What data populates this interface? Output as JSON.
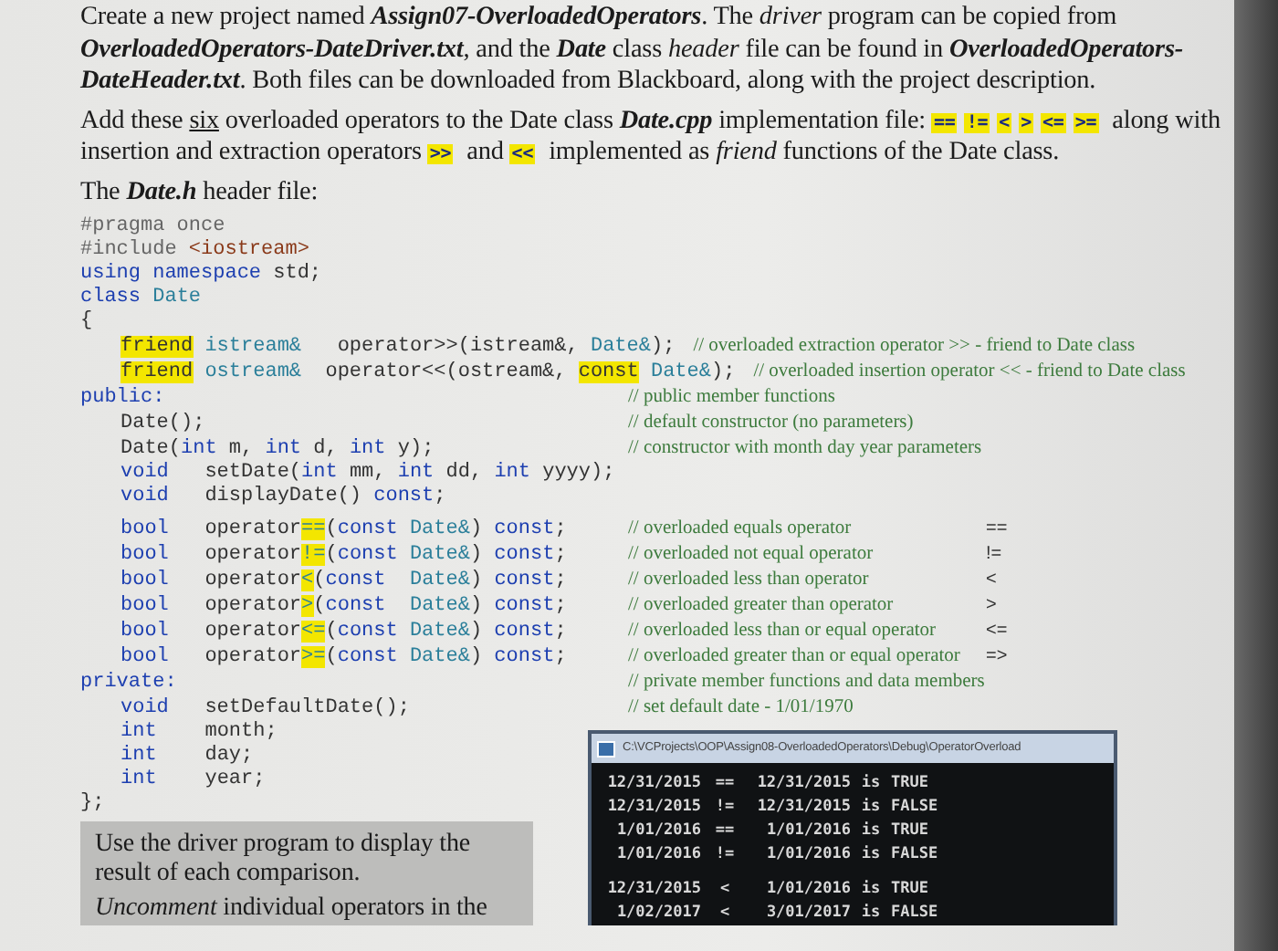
{
  "intro": [
    {
      "segments": [
        {
          "kind": "text",
          "text": "Create a new project named "
        },
        {
          "kind": "bold-italic",
          "text": "Assign07-OverloadedOperators"
        },
        {
          "kind": "text",
          "text": ".  The "
        },
        {
          "kind": "italic",
          "text": "driver"
        },
        {
          "kind": "text",
          "text": " program can be copied from "
        },
        {
          "kind": "bold-italic",
          "text": "OverloadedOperators-DateDriver.txt"
        },
        {
          "kind": "text",
          "text": ", and the "
        },
        {
          "kind": "bold-italic",
          "text": "Date"
        },
        {
          "kind": "text",
          "text": " class "
        },
        {
          "kind": "italic",
          "text": "header"
        },
        {
          "kind": "text",
          "text": " file can be found in "
        },
        {
          "kind": "bold-italic",
          "text": "OverloadedOperators-DateHeader.txt"
        },
        {
          "kind": "text",
          "text": ".  Both files can be downloaded from Blackboard, along with the project description."
        }
      ]
    },
    {
      "segments": [
        {
          "kind": "text",
          "text": "Add these "
        },
        {
          "kind": "underline",
          "text": "six"
        },
        {
          "kind": "text",
          "text": " overloaded operators to the Date class "
        },
        {
          "kind": "bold-italic",
          "text": "Date.cpp"
        },
        {
          "kind": "text",
          "text": " implementation file: "
        },
        {
          "kind": "mark",
          "text": "=="
        },
        {
          "kind": "mark",
          "text": "!="
        },
        {
          "kind": "mark",
          "text": "<"
        },
        {
          "kind": "mark",
          "text": ">"
        },
        {
          "kind": "mark",
          "text": "<="
        },
        {
          "kind": "mark",
          "text": ">="
        },
        {
          "kind": "text",
          "text": " along with insertion and extraction operators "
        },
        {
          "kind": "mark",
          "text": ">>"
        },
        {
          "kind": "text",
          "text": " and "
        },
        {
          "kind": "mark",
          "text": "<<"
        },
        {
          "kind": "text",
          "text": " implemented as "
        },
        {
          "kind": "italic",
          "text": "friend"
        },
        {
          "kind": "text",
          "text": " functions of the Date class."
        }
      ]
    },
    {
      "segments": [
        {
          "kind": "text",
          "text": "The "
        },
        {
          "kind": "bold-italic",
          "text": "Date.h"
        },
        {
          "kind": "text",
          "text": " header file:"
        }
      ]
    }
  ],
  "code": {
    "lines": [
      {
        "indent": false,
        "segments": [
          {
            "kind": "pre",
            "text": "#pragma once"
          }
        ]
      },
      {
        "indent": false,
        "segments": [
          {
            "kind": "pre",
            "text": "#include "
          },
          {
            "kind": "str",
            "text": "<iostream>"
          }
        ]
      },
      {
        "indent": false,
        "segments": [
          {
            "kind": "kw",
            "text": "using namespace"
          },
          {
            "kind": "plain",
            "text": " std;"
          }
        ]
      },
      {
        "indent": false,
        "segments": [
          {
            "kind": "kw",
            "text": "class"
          },
          {
            "kind": "type",
            "text": " Date"
          }
        ]
      },
      {
        "indent": false,
        "segments": [
          {
            "kind": "plain",
            "text": "{"
          }
        ]
      },
      {
        "indent": true,
        "segments": [
          {
            "kind": "hl",
            "text": "friend"
          },
          {
            "kind": "type",
            "text": " istream&"
          },
          {
            "kind": "plain",
            "text": "   operator>>(istream&, "
          },
          {
            "kind": "type",
            "text": "Date&"
          },
          {
            "kind": "plain",
            "text": ");"
          }
        ],
        "comment": "// overloaded extraction operator >> - friend to Date class"
      },
      {
        "indent": true,
        "segments": [
          {
            "kind": "hl",
            "text": "friend"
          },
          {
            "kind": "type",
            "text": " ostream&"
          },
          {
            "kind": "plain",
            "text": "  operator<<(ostream&, "
          },
          {
            "kind": "hl",
            "text": "const"
          },
          {
            "kind": "type",
            "text": " Date&"
          },
          {
            "kind": "plain",
            "text": ");"
          }
        ],
        "comment": "// overloaded insertion  operator << - friend to Date class"
      },
      {
        "indent": false,
        "segments": [
          {
            "kind": "kw",
            "text": "public:"
          }
        ],
        "comment": "// public member functions"
      },
      {
        "indent": true,
        "segments": [
          {
            "kind": "plain",
            "text": "Date();"
          }
        ],
        "comment": "// default constructor (no parameters)"
      },
      {
        "indent": true,
        "segments": [
          {
            "kind": "plain",
            "text": "Date("
          },
          {
            "kind": "kw",
            "text": "int"
          },
          {
            "kind": "plain",
            "text": " m, "
          },
          {
            "kind": "kw",
            "text": "int"
          },
          {
            "kind": "plain",
            "text": " d, "
          },
          {
            "kind": "kw",
            "text": "int"
          },
          {
            "kind": "plain",
            "text": " y);"
          }
        ],
        "comment": "// constructor with month day year parameters"
      },
      {
        "indent": true,
        "segments": [
          {
            "kind": "kw",
            "text": "void"
          },
          {
            "kind": "plain",
            "text": "   setDate("
          },
          {
            "kind": "kw",
            "text": "int"
          },
          {
            "kind": "plain",
            "text": " mm, "
          },
          {
            "kind": "kw",
            "text": "int"
          },
          {
            "kind": "plain",
            "text": " dd, "
          },
          {
            "kind": "kw",
            "text": "int"
          },
          {
            "kind": "plain",
            "text": " yyyy);"
          }
        ]
      },
      {
        "indent": true,
        "segments": [
          {
            "kind": "kw",
            "text": "void"
          },
          {
            "kind": "plain",
            "text": "   displayDate() "
          },
          {
            "kind": "kw",
            "text": "const"
          },
          {
            "kind": "plain",
            "text": ";"
          }
        ]
      },
      {
        "indent": true,
        "gap": true,
        "segments": [
          {
            "kind": "kw",
            "text": "bool"
          },
          {
            "kind": "plain",
            "text": "   operator"
          },
          {
            "kind": "mark",
            "text": "=="
          },
          {
            "kind": "plain",
            "text": "("
          },
          {
            "kind": "kw",
            "text": "const"
          },
          {
            "kind": "type",
            "text": " Date&"
          },
          {
            "kind": "plain",
            "text": ") "
          },
          {
            "kind": "kw",
            "text": "const"
          },
          {
            "kind": "plain",
            "text": ";"
          }
        ],
        "comment": "// overloaded equals operator",
        "symbol": "=="
      },
      {
        "indent": true,
        "segments": [
          {
            "kind": "kw",
            "text": "bool"
          },
          {
            "kind": "plain",
            "text": "   operator"
          },
          {
            "kind": "mark",
            "text": "!="
          },
          {
            "kind": "plain",
            "text": "("
          },
          {
            "kind": "kw",
            "text": "const"
          },
          {
            "kind": "type",
            "text": " Date&"
          },
          {
            "kind": "plain",
            "text": ") "
          },
          {
            "kind": "kw",
            "text": "const"
          },
          {
            "kind": "plain",
            "text": ";"
          }
        ],
        "comment": "// overloaded not equal operator",
        "symbol": "!="
      },
      {
        "indent": true,
        "segments": [
          {
            "kind": "kw",
            "text": "bool"
          },
          {
            "kind": "plain",
            "text": "   operator"
          },
          {
            "kind": "mark",
            "text": "<"
          },
          {
            "kind": "plain",
            "text": "("
          },
          {
            "kind": "kw",
            "text": "const"
          },
          {
            "kind": "type",
            "text": "  Date&"
          },
          {
            "kind": "plain",
            "text": ") "
          },
          {
            "kind": "kw",
            "text": "const"
          },
          {
            "kind": "plain",
            "text": ";"
          }
        ],
        "comment": "// overloaded less than operator",
        "symbol": "<"
      },
      {
        "indent": true,
        "segments": [
          {
            "kind": "kw",
            "text": "bool"
          },
          {
            "kind": "plain",
            "text": "   operator"
          },
          {
            "kind": "mark",
            "text": ">"
          },
          {
            "kind": "plain",
            "text": "("
          },
          {
            "kind": "kw",
            "text": "const"
          },
          {
            "kind": "type",
            "text": "  Date&"
          },
          {
            "kind": "plain",
            "text": ") "
          },
          {
            "kind": "kw",
            "text": "const"
          },
          {
            "kind": "plain",
            "text": ";"
          }
        ],
        "comment": "// overloaded greater than operator",
        "symbol": ">"
      },
      {
        "indent": true,
        "segments": [
          {
            "kind": "kw",
            "text": "bool"
          },
          {
            "kind": "plain",
            "text": "   operator"
          },
          {
            "kind": "mark",
            "text": "<="
          },
          {
            "kind": "plain",
            "text": "("
          },
          {
            "kind": "kw",
            "text": "const"
          },
          {
            "kind": "type",
            "text": " Date&"
          },
          {
            "kind": "plain",
            "text": ") "
          },
          {
            "kind": "kw",
            "text": "const"
          },
          {
            "kind": "plain",
            "text": ";"
          }
        ],
        "comment": "// overloaded less than or equal operator",
        "symbol": "<="
      },
      {
        "indent": true,
        "segments": [
          {
            "kind": "kw",
            "text": "bool"
          },
          {
            "kind": "plain",
            "text": "   operator"
          },
          {
            "kind": "mark",
            "text": ">="
          },
          {
            "kind": "plain",
            "text": "("
          },
          {
            "kind": "kw",
            "text": "const"
          },
          {
            "kind": "type",
            "text": " Date&"
          },
          {
            "kind": "plain",
            "text": ") "
          },
          {
            "kind": "kw",
            "text": "const"
          },
          {
            "kind": "plain",
            "text": ";"
          }
        ],
        "comment": "// overloaded greater than or equal operator",
        "symbol": "=>"
      },
      {
        "indent": false,
        "segments": [
          {
            "kind": "kw",
            "text": "private:"
          }
        ],
        "comment": "// private member functions and data members"
      },
      {
        "indent": true,
        "segments": [
          {
            "kind": "kw",
            "text": "void"
          },
          {
            "kind": "plain",
            "text": "   setDefaultDate();"
          }
        ],
        "comment": "// set default date -  1/01/1970"
      }
    ]
  },
  "lower_code": {
    "lines": [
      {
        "indent": true,
        "segments": [
          {
            "kind": "kw",
            "text": "int"
          },
          {
            "kind": "plain",
            "text": "    month;"
          }
        ]
      },
      {
        "indent": true,
        "segments": [
          {
            "kind": "kw",
            "text": "int"
          },
          {
            "kind": "plain",
            "text": "    day;"
          }
        ]
      },
      {
        "indent": true,
        "segments": [
          {
            "kind": "kw",
            "text": "int"
          },
          {
            "kind": "plain",
            "text": "    year;"
          }
        ]
      },
      {
        "indent": false,
        "segments": [
          {
            "kind": "plain",
            "text": "};"
          }
        ]
      }
    ]
  },
  "note": [
    {
      "segments": [
        {
          "kind": "text",
          "text": "Use the driver program to display the result of each comparison."
        }
      ]
    },
    {
      "segments": [
        {
          "kind": "italic",
          "text": "Uncomment"
        },
        {
          "kind": "text",
          "text": " individual operators in the"
        }
      ]
    }
  ],
  "console": {
    "title": "C:\\VCProjects\\OOP\\Assign08-OverloadedOperators\\Debug\\OperatorOverload",
    "rows": [
      {
        "left": "12/31/2015",
        "op": "==",
        "right": "12/31/2015",
        "verb": "is",
        "result": "TRUE",
        "group_start": false
      },
      {
        "left": "12/31/2015",
        "op": "!=",
        "right": "12/31/2015",
        "verb": "is",
        "result": "FALSE",
        "group_start": false
      },
      {
        "left": "1/01/2016",
        "op": "==",
        "right": "1/01/2016",
        "verb": "is",
        "result": "TRUE",
        "group_start": false
      },
      {
        "left": "1/01/2016",
        "op": "!=",
        "right": "1/01/2016",
        "verb": "is",
        "result": "FALSE",
        "group_start": false
      },
      {
        "left": "12/31/2015",
        "op": "<",
        "right": "1/01/2016",
        "verb": "is",
        "result": "TRUE",
        "group_start": true
      },
      {
        "left": "1/02/2017",
        "op": "<",
        "right": "3/01/2017",
        "verb": "is",
        "result": "FALSE",
        "group_start": false
      }
    ]
  }
}
